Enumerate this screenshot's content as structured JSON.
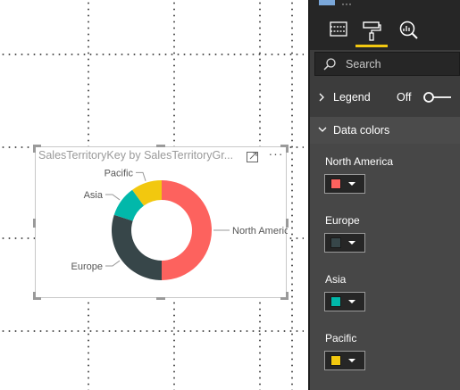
{
  "visual": {
    "title": "SalesTerritoryKey by SalesTerritoryGr...",
    "more_label": "···"
  },
  "chart_data": {
    "type": "pie",
    "categories": [
      "North America",
      "Europe",
      "Asia",
      "Pacific"
    ],
    "values": [
      50,
      30,
      10,
      10
    ],
    "colors": [
      "#fd625e",
      "#374649",
      "#01b8aa",
      "#f2c80f"
    ],
    "title": "SalesTerritoryKey by SalesTerritoryGr...",
    "legend": "off"
  },
  "panel": {
    "tabs": [
      "fields-icon",
      "format-paint-roller-icon",
      "analytics-magnifier-icon"
    ],
    "active_tab": "format-paint-roller-icon",
    "search_placeholder": "Search",
    "legend": {
      "label": "Legend",
      "state": "Off"
    },
    "data_colors": {
      "label": "Data colors",
      "items": [
        {
          "name": "North America",
          "color": "#fd625e"
        },
        {
          "name": "Europe",
          "color": "#374649"
        },
        {
          "name": "Asia",
          "color": "#01b8aa"
        },
        {
          "name": "Pacific",
          "color": "#f2c80f"
        }
      ]
    }
  }
}
